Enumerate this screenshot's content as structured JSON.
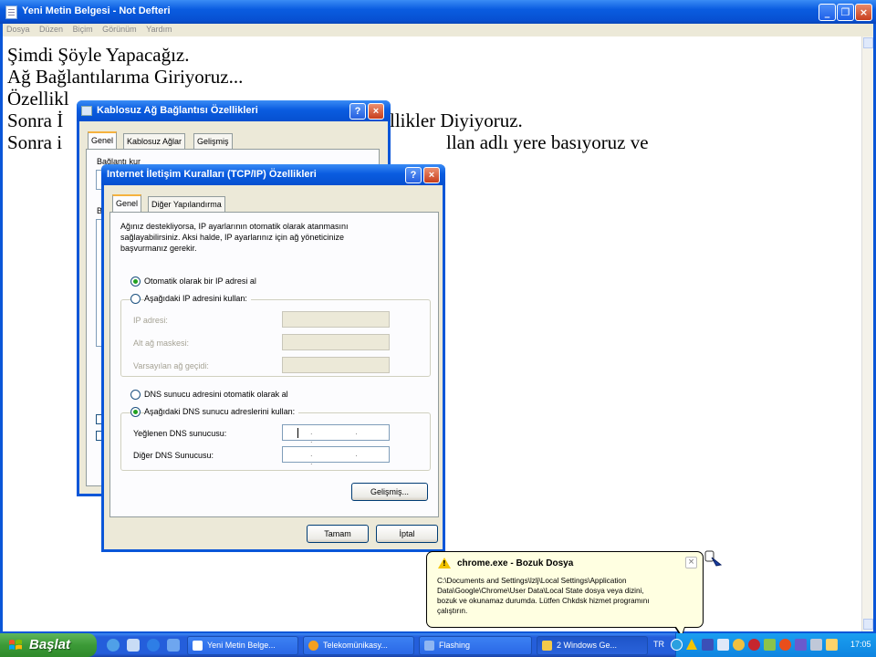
{
  "notepad": {
    "title": "Yeni Metin Belgesi - Not Defteri",
    "menu": [
      "Dosya",
      "Düzen",
      "Biçim",
      "Görünüm",
      "Yardım"
    ],
    "lines": [
      "Şimdi Şöyle Yapacağız.",
      "Ağ Bağlantılarıma Giriyoruz...",
      "Özellikler Diyiyoruz.",
      "Sonra İ",
      "llikler Diyiyoruz.",
      "Sonra i",
      "llan adlı yere basıyoruz ve",
      "Özellikl"
    ]
  },
  "wireless_dialog": {
    "title": "Kablosuz Ağ Bağlantısı Özellikleri",
    "tabs": [
      "Genel",
      "Kablosuz Ağlar",
      "Gelişmiş"
    ],
    "fragments": [
      "Bağlantı kur",
      "B"
    ]
  },
  "tcpip_dialog": {
    "title": "Internet İletişim Kuralları (TCP/IP) Özellikleri",
    "tabs": [
      "Genel",
      "Diğer Yapılandırma"
    ],
    "intro": [
      "Ağınız destekliyorsa, IP ayarlarının otomatik olarak atanmasını",
      "sağlayabilirsiniz. Aksi halde, IP ayarlarınız için ağ yöneticinize",
      "başvurmanız gerekir."
    ],
    "ip_auto": "Otomatik olarak bir IP adresi al",
    "ip_manual": "Aşağıdaki IP adresini kullan:",
    "ip_address_label": "IP adresi:",
    "subnet_label": "Alt ağ maskesi:",
    "gateway_label": "Varsayılan ağ geçidi:",
    "dns_auto": "DNS sunucu adresini otomatik olarak al",
    "dns_manual": "Aşağıdaki DNS sunucu adreslerini kullan:",
    "preferred_dns_label": "Yeğlenen DNS sunucusu:",
    "alternate_dns_label": "Diğer DNS Sunucusu:",
    "ip_dots": ". . .",
    "advanced_button": "Gelişmiş...",
    "ok_button": "Tamam",
    "cancel_button": "İptal",
    "selected_ip_mode": "automatic",
    "selected_dns_mode": "manual"
  },
  "balloon": {
    "title": "chrome.exe - Bozuk Dosya",
    "body": [
      "C:\\Documents and Settings\\lzlj\\Local Settings\\Application",
      "Data\\Google\\Chrome\\User Data\\Local State dosya veya dizini,",
      "bozuk ve okunamaz durumda. Lütfen Chkdsk hizmet programını",
      "çalıştırın."
    ],
    "close": "×"
  },
  "taskbar": {
    "start_label": "Başlat",
    "tasks": [
      {
        "label": "Yeni Metin Belge...",
        "icon_color": "#ffffff"
      },
      {
        "label": "Telekomünikasy...",
        "icon_color": "#f4a020"
      },
      {
        "label": "Flashing",
        "icon_color": "#3a7be8"
      },
      {
        "label": "2 Windows Ge...",
        "icon_color": "#f3c94a"
      }
    ],
    "language": "TR",
    "clock": "17:05"
  },
  "colors": {
    "xp_blue": "#0a56d8",
    "dialog_face": "#ece9d8",
    "start_green": "#3c9a37",
    "balloon_bg": "#ffffe1",
    "warning_yellow": "#f3c400"
  }
}
